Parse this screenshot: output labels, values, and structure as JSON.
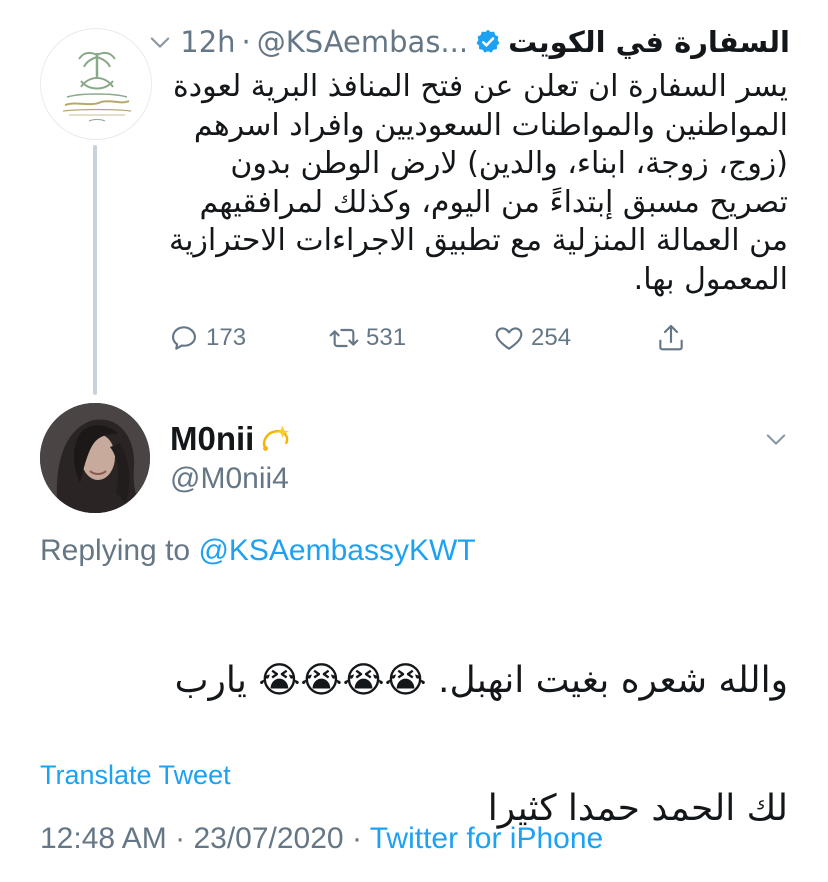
{
  "parent_tweet": {
    "author_name": "السفارة في الكويت",
    "verified_icon": "verified-badge-icon",
    "handle": "@KSAembas...",
    "separator": "·",
    "time": "12h",
    "text": "يسر السفارة ان تعلن عن فتح المنافذ البرية لعودة\nالمواطنين والمواطنات السعوديين وافراد اسرهم\n(زوج، زوجة، ابناء، والدين) لارض الوطن بدون\nتصريح مسبق إبتداءً من اليوم، وكذلك لمرافقيهم\nمن العمالة المنزلية مع تطبيق الاجراءات الاحترازية\nالمعمول بها.",
    "actions": {
      "reply_count": "173",
      "retweet_count": "531",
      "like_count": "254"
    }
  },
  "reply_tweet": {
    "author_name": "M0nii",
    "name_emoji": "dizzy-sparkle-icon",
    "handle": "@M0nii4",
    "replying_prefix": "Replying to",
    "replying_to": "@KSAembassyKWT",
    "text_line1": "والله شعره بغيت انهبل. 😭😭😭😭 يارب",
    "text_line2": "لك الحمد حمدا كثيرا",
    "translate_label": "Translate Tweet",
    "timestamp": "12:48 AM",
    "date": "23/07/2020",
    "meta_separator": "·",
    "source": "Twitter for iPhone"
  },
  "colors": {
    "accent": "#1da1f2",
    "secondary_text": "#657786",
    "primary_text": "#14171a",
    "thread_line": "#c9d2d9",
    "emblem_green": "#8aa88a",
    "emblem_gold": "#b8a86e"
  }
}
